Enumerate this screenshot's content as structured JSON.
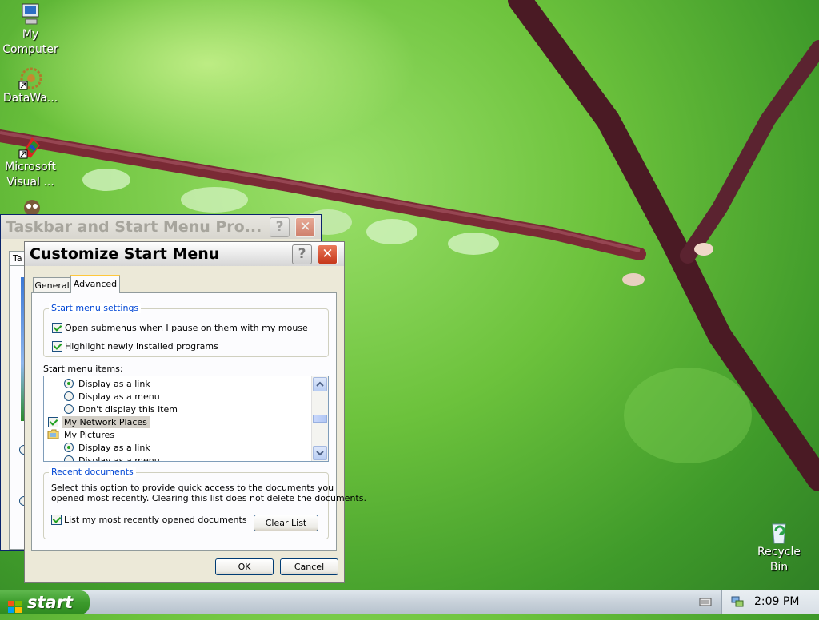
{
  "desktop": {
    "icons": [
      {
        "label_line1": "My",
        "label_line2": "Computer",
        "icon": "computer-icon"
      },
      {
        "label_line1": "DataWa...",
        "label_line2": "",
        "icon": "datawarrior-icon"
      },
      {
        "label_line1": "Microsoft",
        "label_line2": "Visual ...",
        "icon": "visual-studio-icon"
      },
      {
        "label_line1": "Recycle",
        "label_line2": "Bin",
        "icon": "recycle-bin-icon"
      }
    ]
  },
  "back_window": {
    "title": "Taskbar and Start Menu Pro...",
    "tab_fragment": "Ta"
  },
  "dialog": {
    "title": "Customize Start Menu",
    "tabs": [
      {
        "label": "General",
        "active": false
      },
      {
        "label": "Advanced",
        "active": true
      }
    ],
    "settings_group": {
      "legend": "Start menu settings",
      "options": [
        {
          "label": "Open submenus when I pause on them with my mouse",
          "checked": true
        },
        {
          "label": "Highlight newly installed programs",
          "checked": true
        }
      ]
    },
    "items_label": "Start menu items:",
    "items": [
      {
        "type": "radio",
        "label": "Display as a link",
        "checked": true
      },
      {
        "type": "radio",
        "label": "Display as a menu",
        "checked": false
      },
      {
        "type": "radio",
        "label": "Don't display this item",
        "checked": false
      },
      {
        "type": "checkbox",
        "label": "My Network Places",
        "checked": true,
        "selected": true
      },
      {
        "type": "folder",
        "label": "My Pictures"
      },
      {
        "type": "radio",
        "label": "Display as a link",
        "checked": true
      },
      {
        "type": "radio",
        "label": "Display as a menu",
        "checked": false
      }
    ],
    "recent_group": {
      "legend": "Recent documents",
      "description_line1": "Select this option to provide quick access to the documents you",
      "description_line2": "opened most recently.  Clearing this list does not delete the documents.",
      "checkbox_label": "List my most recently opened documents",
      "checked": true,
      "clear_button": "Clear List"
    },
    "ok_button": "OK",
    "cancel_button": "Cancel",
    "help_glyph": "?",
    "close_glyph": "✕"
  },
  "taskbar": {
    "start_label": "start",
    "clock": "2:09 PM"
  },
  "colors": {
    "title_active_text": "#000000",
    "legend_blue": "#0046d5",
    "start_green": "#3c9b2c",
    "check_green": "#21a121"
  }
}
